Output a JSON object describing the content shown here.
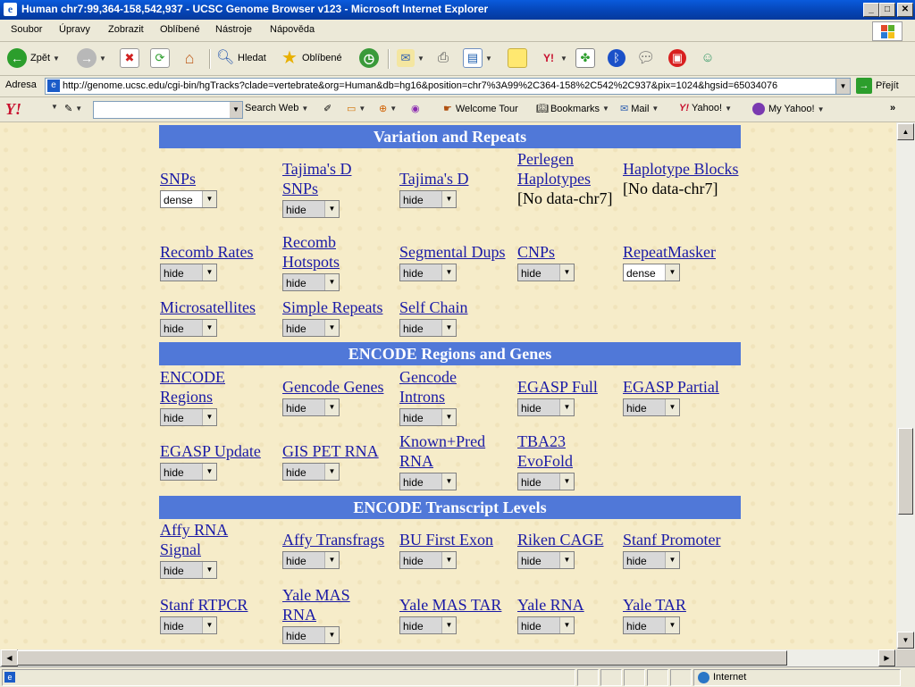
{
  "window": {
    "title": "Human chr7:99,364-158,542,937 - UCSC Genome Browser v123 - Microsoft Internet Explorer"
  },
  "menu": [
    "Soubor",
    "Úpravy",
    "Zobrazit",
    "Oblíbené",
    "Nástroje",
    "Nápověda"
  ],
  "toolbar": {
    "back": "Zpět",
    "search": "Hledat",
    "favorites": "Oblíbené"
  },
  "address": {
    "label": "Adresa",
    "url": "http://genome.ucsc.edu/cgi-bin/hgTracks?clade=vertebrate&org=Human&db=hg16&position=chr7%3A99%2C364-158%2C542%2C937&pix=1024&hgsid=65034076",
    "go": "Přejít"
  },
  "yahoo_bar": {
    "logo": "Y!",
    "search_web": "Search Web",
    "welcome_tour": "Welcome Tour",
    "bookmarks": "Bookmarks",
    "mail": "Mail",
    "yahoo": "Yahoo!",
    "my_yahoo": "My Yahoo!",
    "more": "»"
  },
  "sections": [
    {
      "title": "Variation and Repeats",
      "rows": [
        [
          {
            "name": "SNPs",
            "value": "dense"
          },
          {
            "name": "Tajima's D SNPs",
            "value": "hide"
          },
          {
            "name": "Tajima's D",
            "value": "hide"
          },
          {
            "name": "Perlegen Haplotypes",
            "nodata": "[No data-chr7]"
          },
          {
            "name": "Haplotype Blocks",
            "nodata": "[No data-chr7]"
          }
        ],
        [
          {
            "name": "Recomb Rates",
            "value": "hide"
          },
          {
            "name": "Recomb Hotspots",
            "value": "hide"
          },
          {
            "name": "Segmental Dups",
            "value": "hide"
          },
          {
            "name": "CNPs",
            "value": "hide"
          },
          {
            "name": "RepeatMasker",
            "value": "dense"
          }
        ],
        [
          {
            "name": "Microsatellites",
            "value": "hide"
          },
          {
            "name": "Simple Repeats",
            "value": "hide"
          },
          {
            "name": "Self Chain",
            "value": "hide"
          }
        ]
      ]
    },
    {
      "title": "ENCODE Regions and Genes",
      "rows": [
        [
          {
            "name": "ENCODE Regions",
            "value": "hide"
          },
          {
            "name": "Gencode Genes",
            "value": "hide"
          },
          {
            "name": "Gencode Introns",
            "value": "hide"
          },
          {
            "name": "EGASP Full",
            "value": "hide"
          },
          {
            "name": "EGASP Partial",
            "value": "hide"
          }
        ],
        [
          {
            "name": "EGASP Update",
            "value": "hide"
          },
          {
            "name": "GIS PET RNA",
            "value": "hide"
          },
          {
            "name": "Known+Pred RNA",
            "value": "hide"
          },
          {
            "name": "TBA23 EvoFold",
            "value": "hide"
          }
        ]
      ]
    },
    {
      "title": "ENCODE Transcript Levels",
      "rows": [
        [
          {
            "name": "Affy RNA Signal",
            "value": "hide"
          },
          {
            "name": "Affy Transfrags",
            "value": "hide"
          },
          {
            "name": "BU First Exon",
            "value": "hide"
          },
          {
            "name": "Riken CAGE",
            "value": "hide"
          },
          {
            "name": "Stanf Promoter",
            "value": "hide"
          }
        ],
        [
          {
            "name": "Stanf RTPCR",
            "value": "hide"
          },
          {
            "name": "Yale MAS RNA",
            "value": "hide"
          },
          {
            "name": "Yale MAS TAR",
            "value": "hide"
          },
          {
            "name": "Yale RNA",
            "value": "hide"
          },
          {
            "name": "Yale TAR",
            "value": "hide"
          }
        ]
      ]
    }
  ],
  "status": {
    "zone": "Internet"
  },
  "colors": {
    "section_header": "#5078d8",
    "link": "#1a1aa6",
    "page_bg": "#f6ecc9",
    "titlebar": "#0543b4"
  }
}
